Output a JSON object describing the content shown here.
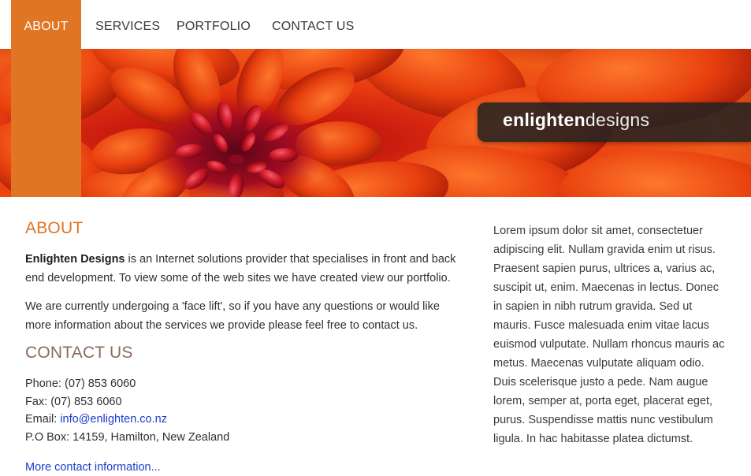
{
  "nav": {
    "items": [
      {
        "label": "ABOUT",
        "active": true
      },
      {
        "label": "SERVICES",
        "active": false
      },
      {
        "label": "PORTFOLIO",
        "active": false
      },
      {
        "label": "CONTACT US",
        "active": false
      }
    ]
  },
  "banner": {
    "brand_bold": "enlighten",
    "brand_light": "designs"
  },
  "about": {
    "title": "ABOUT",
    "p1_bold": "Enlighten Designs",
    "p1_rest": " is an Internet solutions provider that specialises in front and back end development. To view some of the web sites we have created view our portfolio.",
    "p2": "We are currently undergoing a 'face lift', so if you have any questions or would like more information about the services we provide please feel free to contact us."
  },
  "contact": {
    "title": "CONTACT US",
    "phone": "Phone: (07) 853 6060",
    "fax": "Fax: (07) 853 6060",
    "email_label": "Email: ",
    "email": "info@enlighten.co.nz",
    "po_box": "P.O Box: 14159, Hamilton, New Zealand",
    "more_link": "More contact information..."
  },
  "sidebar": {
    "text": "Lorem ipsum dolor sit amet, consectetuer adipiscing elit. Nullam gravida enim ut risus. Praesent sapien purus, ultrices a, varius ac, suscipit ut, enim. Maecenas in lectus. Donec in sapien in nibh rutrum gravida. Sed ut mauris. Fusce malesuada enim vitae lacus euismod vulputate. Nullam rhoncus mauris ac metus. Maecenas vulputate aliquam odio. Duis scelerisque justo a pede. Nam augue lorem, semper at, porta eget, placerat eget, purus. Suspendisse mattis nunc vestibulum ligula. In hac habitasse platea dictumst."
  },
  "colors": {
    "accent": "#e07524",
    "contact_heading": "#8a6a5f",
    "link": "#1a3cc8",
    "banner_red": "#d8360e"
  }
}
